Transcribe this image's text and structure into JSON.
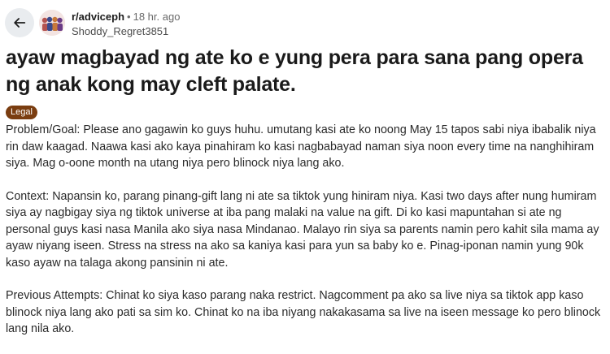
{
  "header": {
    "back_icon": "arrow-left-icon",
    "avatar_icon": "subreddit-avatar-icon",
    "subreddit": "r/adviceph",
    "separator": "•",
    "time": "18 hr. ago",
    "author": "Shoddy_Regret3851"
  },
  "post": {
    "title": "ayaw magbayad ng ate ko e yung pera para sana pang opera ng anak kong may cleft palate.",
    "flair": "Legal",
    "flair_color": "#7a3d10",
    "paragraphs": [
      "Problem/Goal: Please ano gagawin ko guys huhu. umutang kasi ate ko noong May 15 tapos sabi niya ibabalik niya rin daw kaagad. Naawa kasi ako kaya pinahiram ko kasi nagbabayad naman siya noon every time na nanghihiram siya. Mag o-oone month na utang niya pero blinock niya lang ako.",
      "Context: Napansin ko, parang pinang-gift lang ni ate sa tiktok yung hiniram niya. Kasi two days after nung humiram siya ay nagbigay siya ng tiktok universe at iba pang malaki na value na gift. Di ko kasi mapuntahan si ate ng personal guys kasi nasa Manila ako siya nasa Mindanao. Malayo rin siya sa parents namin pero kahit sila mama ay ayaw niyang iseen. Stress na stress na ako sa kaniya kasi para yun sa baby ko e. Pinag-iponan namin yung 90k kaso ayaw na talaga akong pansinin ni ate.",
      "Previous Attempts: Chinat ko siya kaso parang naka restrict. Nagcomment pa ako sa live niya sa tiktok app kaso blinock niya lang ako pati sa sim ko. Chinat ko na iba niyang nakakasama sa live na iseen message ko pero blinock lang nila ako."
    ]
  }
}
